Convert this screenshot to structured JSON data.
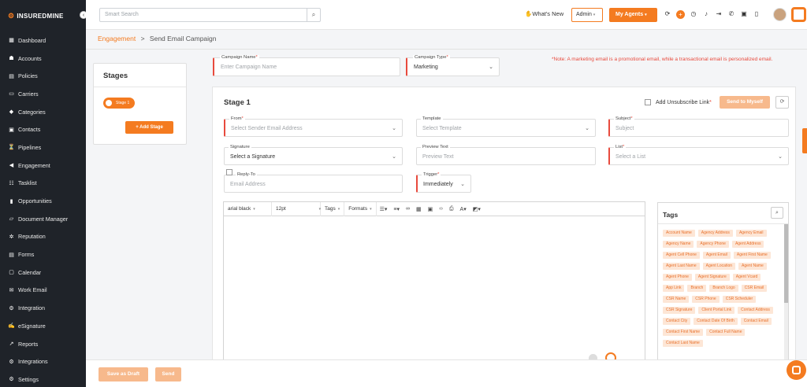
{
  "brand": {
    "name": "INSUREDMINE",
    "accent": "#f47b20",
    "error": "#e84a3d"
  },
  "sidebar": {
    "items": [
      {
        "label": "Dashboard",
        "icon": "dashboard-icon"
      },
      {
        "label": "Accounts",
        "icon": "accounts-icon"
      },
      {
        "label": "Policies",
        "icon": "policies-icon"
      },
      {
        "label": "Carriers",
        "icon": "carriers-icon"
      },
      {
        "label": "Categories",
        "icon": "categories-icon"
      },
      {
        "label": "Contacts",
        "icon": "contacts-icon"
      },
      {
        "label": "Pipelines",
        "icon": "pipelines-icon"
      },
      {
        "label": "Engagement",
        "icon": "megaphone-icon"
      },
      {
        "label": "Tasklist",
        "icon": "tasklist-icon"
      },
      {
        "label": "Opportunities",
        "icon": "opportunities-icon"
      },
      {
        "label": "Document Manager",
        "icon": "folder-icon"
      },
      {
        "label": "Reputation",
        "icon": "reputation-icon"
      },
      {
        "label": "Forms",
        "icon": "forms-icon"
      },
      {
        "label": "Calendar",
        "icon": "calendar-icon"
      },
      {
        "label": "Work Email",
        "icon": "mail-icon"
      },
      {
        "label": "Integration",
        "icon": "integration-icon"
      },
      {
        "label": "eSignature",
        "icon": "signature-icon"
      },
      {
        "label": "Reports",
        "icon": "reports-icon"
      },
      {
        "label": "Integrations",
        "icon": "integrations-icon"
      },
      {
        "label": "Settings",
        "icon": "gear-icon"
      }
    ]
  },
  "topbar": {
    "search_placeholder": "Smart Search",
    "whats_new": "What's New",
    "admin": "Admin",
    "agents": "My Agents"
  },
  "breadcrumb": {
    "parent": "Engagement",
    "separator": ">",
    "current": "Send Email Campaign"
  },
  "stages": {
    "title": "Stages",
    "items": [
      "Stage 1"
    ],
    "add_label": "+ Add Stage"
  },
  "campaign": {
    "name_label": "Campaign Name",
    "name_placeholder": "Enter Campaign Name",
    "type_label": "Campaign Type",
    "type_value": "Marketing",
    "note": "*Note: A marketing email is a promotional email, while a transactional email is personalized email."
  },
  "stage_form": {
    "title": "Stage 1",
    "unsubscribe_label": "Add Unsubscribe Link",
    "send_self": "Send to Myself",
    "from_label": "From",
    "from_placeholder": "Select Sender Email Address",
    "template_label": "Template",
    "template_placeholder": "Select Template",
    "subject_label": "Subject",
    "subject_placeholder": "Subject",
    "signature_label": "Signature",
    "signature_value": "Select a Signature",
    "preview_label": "Preview Text",
    "preview_placeholder": "Preview Text",
    "list_label": "List",
    "list_placeholder": "Select a List",
    "reply_label": "Reply-To",
    "reply_placeholder": "Email Address",
    "trigger_label": "Trigger",
    "trigger_value": "Immediately"
  },
  "editor": {
    "font": "arial black",
    "size": "12pt",
    "tags": "Tags",
    "formats": "Formats"
  },
  "tags_panel": {
    "title": "Tags",
    "items": [
      "Account Name",
      "Agency Address",
      "Agency Email",
      "Agency Name",
      "Agency Phone",
      "Agent Address",
      "Agent Cell Phone",
      "Agent Email",
      "Agent First Name",
      "Agent Last Name",
      "Agent Location",
      "Agent Name",
      "Agent Phone",
      "Agent Signature",
      "Agent Vcard",
      "App Link",
      "Branch",
      "Branch Logo",
      "CSR Email",
      "CSR Name",
      "CSR Phone",
      "CSR Scheduler",
      "CSR Signature",
      "Client Portal Link",
      "Contact Address",
      "Contact City",
      "Contact Date Of Birth",
      "Contact Email",
      "Contact First Name",
      "Contact Full Name",
      "Contact Last Name"
    ]
  },
  "footer": {
    "save_draft": "Save as Draft",
    "send": "Send"
  }
}
